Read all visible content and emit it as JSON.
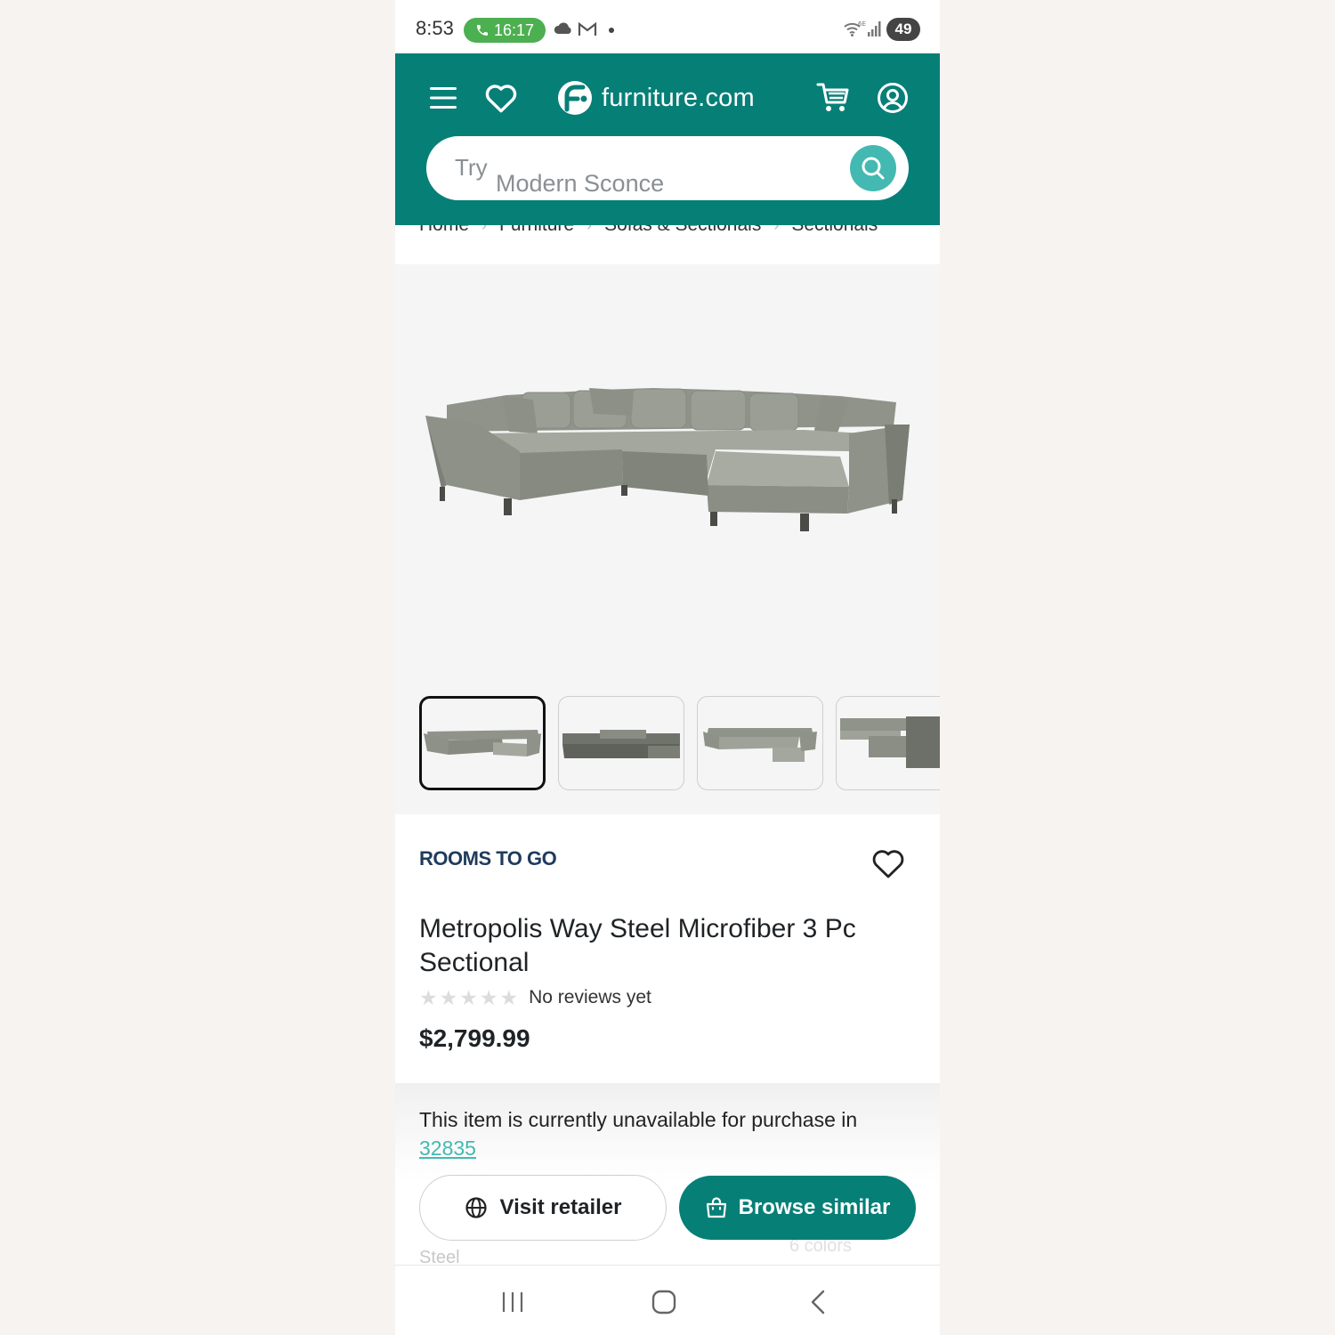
{
  "status_bar": {
    "time": "8:53",
    "call_timer": "16:17",
    "battery": "49",
    "icons": [
      "phone-icon",
      "cloud-icon",
      "gmail-icon",
      "wifi-6e-icon",
      "signal-icon"
    ]
  },
  "header": {
    "brand": "furniture.com",
    "background_color": "#067f77",
    "icons": [
      "menu-icon",
      "heart-icon",
      "cart-icon",
      "account-icon"
    ],
    "search": {
      "prefix": "Try",
      "placeholder": "Modern Sconce",
      "button_color": "#43b9b1"
    }
  },
  "breadcrumb": [
    "Home",
    "Furniture",
    "Sofas & Sectionals",
    "Sectionals"
  ],
  "gallery": {
    "thumbnail_count_visible": 4,
    "selected_index": 0
  },
  "product": {
    "retailer": "ROOMS TO GO",
    "title": "Metropolis Way Steel Microfiber 3 Pc Sectional",
    "rating_stars": 0,
    "reviews_text": "No reviews yet",
    "price": "$2,799.99"
  },
  "availability": {
    "message": "This item is currently unavailable for purchase in",
    "zip": "32835",
    "visit_label": "Visit retailer",
    "browse_label": "Browse similar",
    "obscured_left": "Steel",
    "obscured_right": "6 colors"
  },
  "nav_bar": {
    "icons": [
      "recent-apps-icon",
      "home-icon",
      "back-icon"
    ]
  }
}
